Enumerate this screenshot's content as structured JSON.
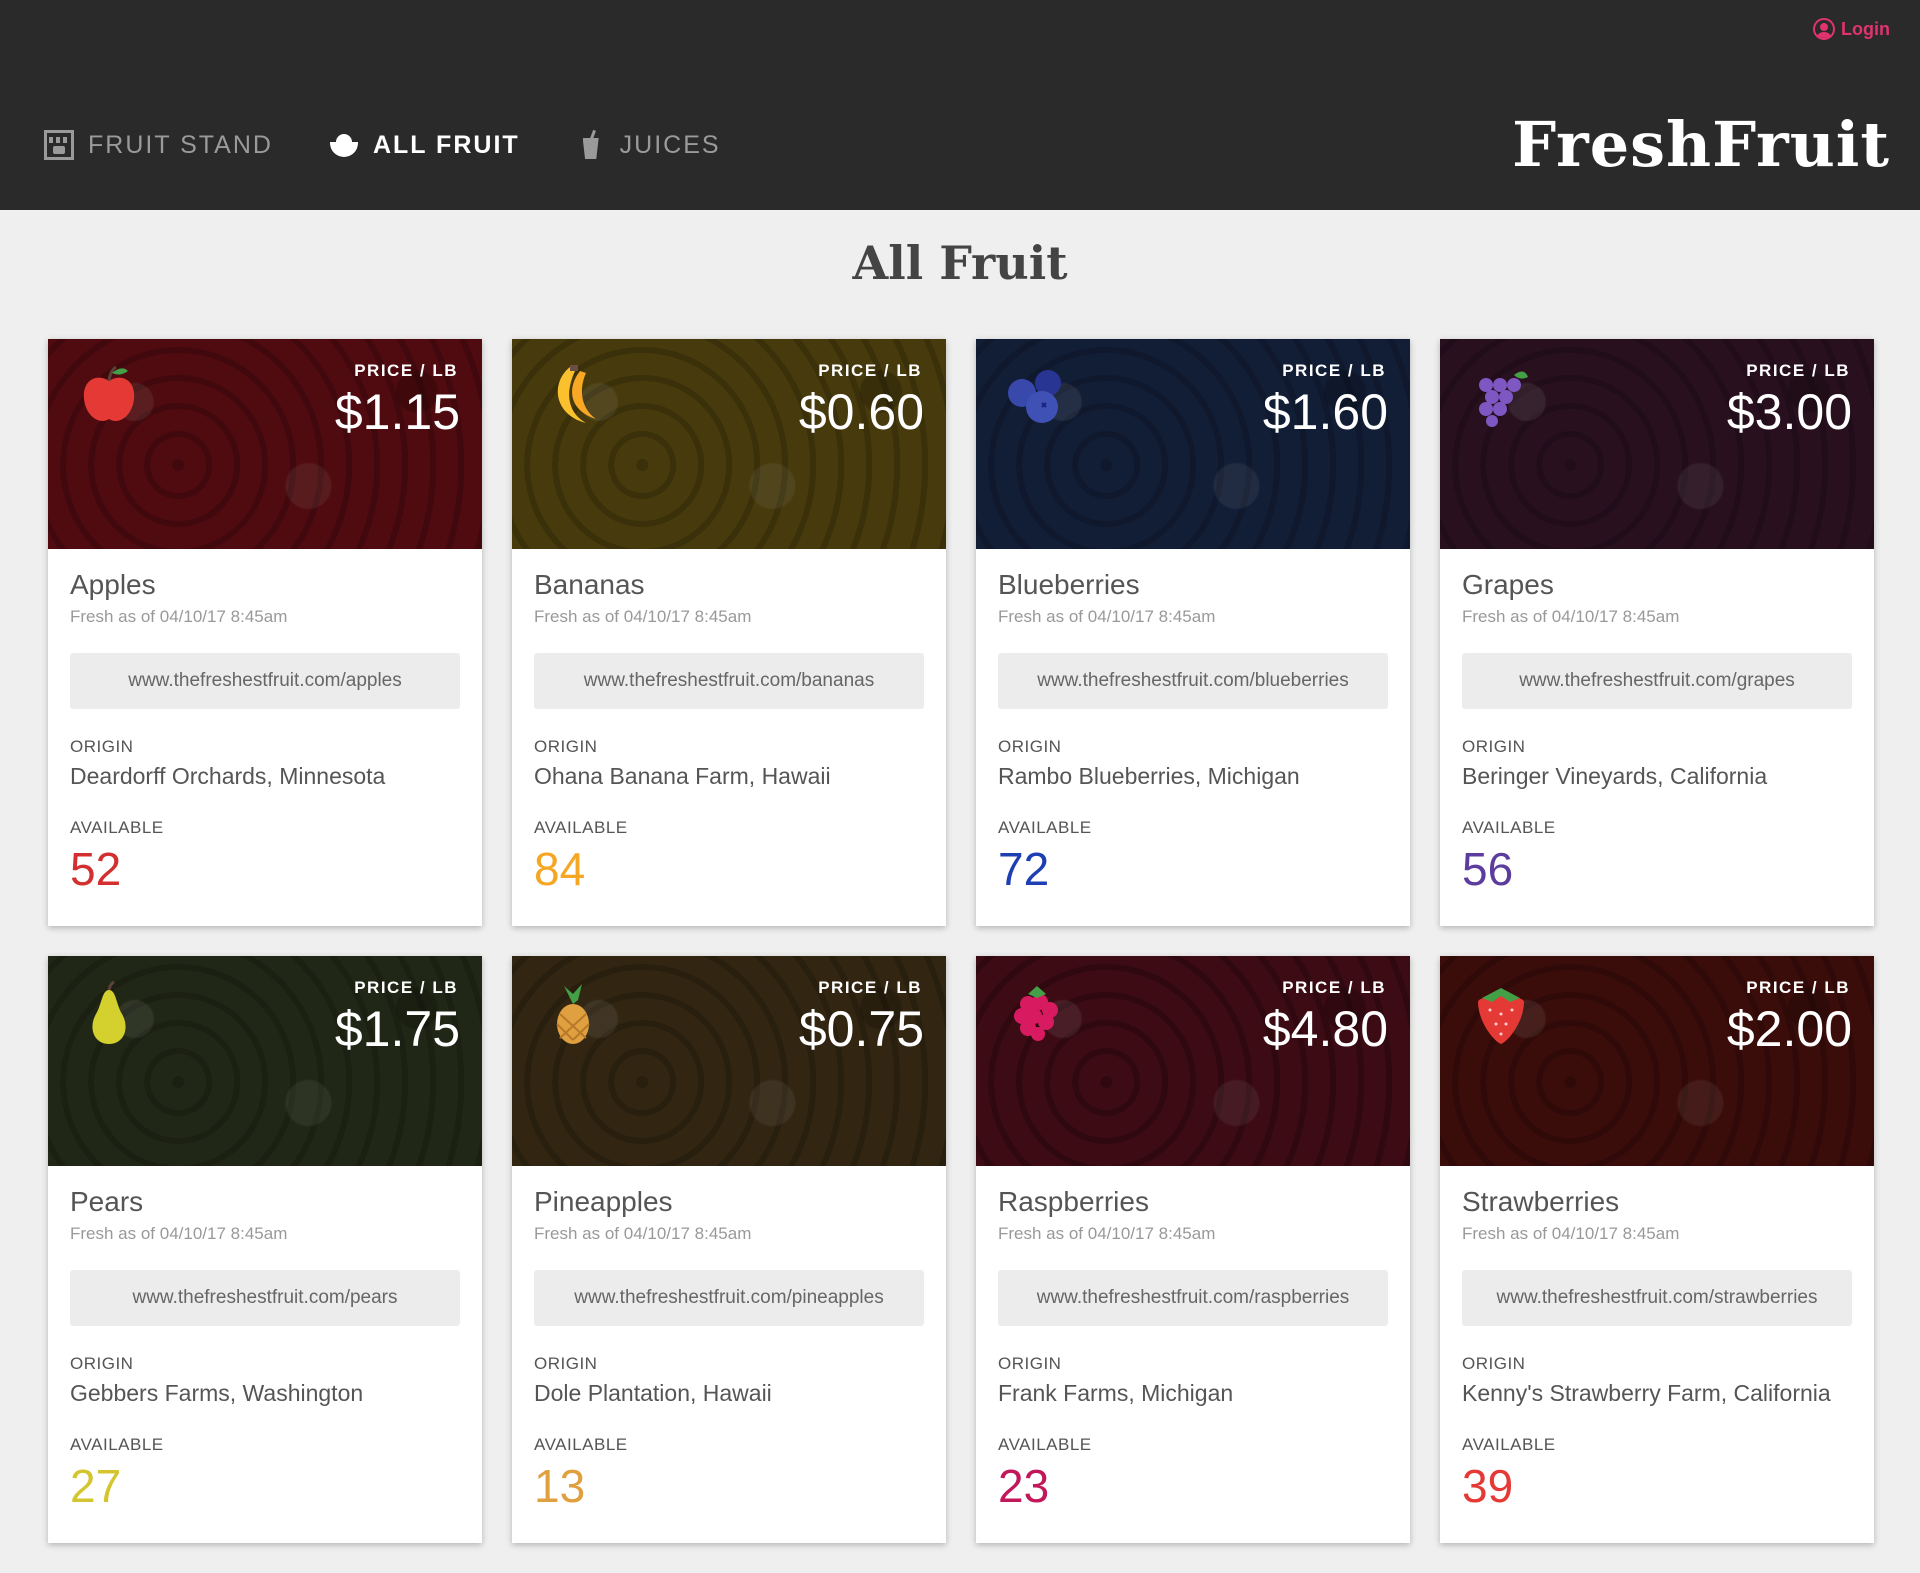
{
  "header": {
    "login_label": "Login",
    "brand": "FreshFruit",
    "nav": [
      {
        "label": "FRUIT STAND",
        "icon": "fruit-stand-icon"
      },
      {
        "label": "ALL FRUIT",
        "icon": "fruit-bowl-icon",
        "active": true
      },
      {
        "label": "JUICES",
        "icon": "juice-icon"
      }
    ]
  },
  "page": {
    "title": "All Fruit"
  },
  "labels": {
    "price": "PRICE / LB",
    "origin": "ORIGIN",
    "available": "AVAILABLE"
  },
  "fruits": [
    {
      "name": "Apples",
      "icon": "apple-icon",
      "price": "$1.15",
      "fresh": "Fresh as of 04/10/17 8:45am",
      "url": "www.thefreshestfruit.com/apples",
      "origin": "Deardorff Orchards, Minnesota",
      "available": "52",
      "color": "#d32f2f",
      "bg": "#7a1218"
    },
    {
      "name": "Bananas",
      "icon": "banana-icon",
      "price": "$0.60",
      "fresh": "Fresh as of 04/10/17 8:45am",
      "url": "www.thefreshestfruit.com/bananas",
      "origin": "Ohana Banana Farm, Hawaii",
      "available": "84",
      "color": "#f5a623",
      "bg": "#6d5a13"
    },
    {
      "name": "Blueberries",
      "icon": "blueberry-icon",
      "price": "$1.60",
      "fresh": "Fresh as of 04/10/17 8:45am",
      "url": "www.thefreshestfruit.com/blueberries",
      "origin": "Rambo Blueberries, Michigan",
      "available": "72",
      "color": "#1e3fb4",
      "bg": "#1d2d54"
    },
    {
      "name": "Grapes",
      "icon": "grape-icon",
      "price": "$3.00",
      "fresh": "Fresh as of 04/10/17 8:45am",
      "url": "www.thefreshestfruit.com/grapes",
      "origin": "Beringer Vineyards, California",
      "available": "56",
      "color": "#5c3d9e",
      "bg": "#3e1a30"
    },
    {
      "name": "Pears",
      "icon": "pear-icon",
      "price": "$1.75",
      "fresh": "Fresh as of 04/10/17 8:45am",
      "url": "www.thefreshestfruit.com/pears",
      "origin": "Gebbers Farms, Washington",
      "available": "27",
      "color": "#d4c52f",
      "bg": "#333d22"
    },
    {
      "name": "Pineapples",
      "icon": "pineapple-icon",
      "price": "$0.75",
      "fresh": "Fresh as of 04/10/17 8:45am",
      "url": "www.thefreshestfruit.com/pineapples",
      "origin": "Dole Plantation, Hawaii",
      "available": "13",
      "color": "#e0a040",
      "bg": "#4e3a1c"
    },
    {
      "name": "Raspberries",
      "icon": "raspberry-icon",
      "price": "$4.80",
      "fresh": "Fresh as of 04/10/17 8:45am",
      "url": "www.thefreshestfruit.com/raspberries",
      "origin": "Frank Farms, Michigan",
      "available": "23",
      "color": "#c2185b",
      "bg": "#5c1220"
    },
    {
      "name": "Strawberries",
      "icon": "strawberry-icon",
      "price": "$2.00",
      "fresh": "Fresh as of 04/10/17 8:45am",
      "url": "www.thefreshestfruit.com/strawberries",
      "origin": "Kenny's Strawberry Farm, California",
      "available": "39",
      "color": "#e53935",
      "bg": "#5a1410"
    }
  ]
}
